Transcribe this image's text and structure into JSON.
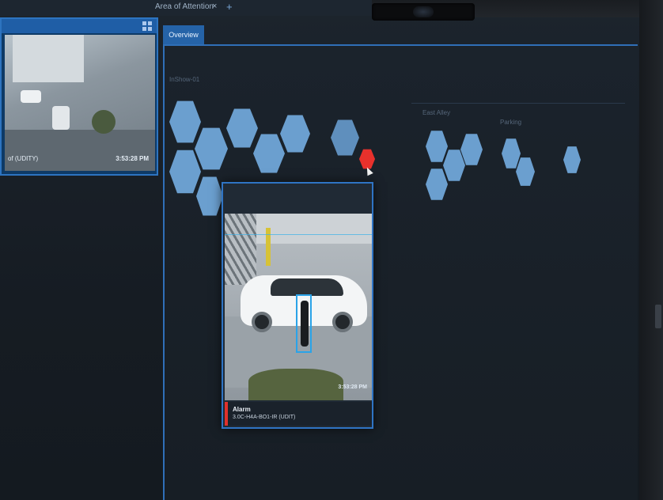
{
  "tabs": {
    "active_tab_title": "Area of Attention",
    "close_glyph": "×",
    "add_glyph": "+",
    "overview_label": "Overview"
  },
  "left_tile": {
    "label": "of (UDITY)",
    "timestamp": "3:53:28 PM"
  },
  "groups": {
    "group1_label": "InShow-01",
    "group2_label": "East Alley",
    "group3_label": "Parking"
  },
  "alarm_popup": {
    "timestamp": "3:53:28 PM",
    "title": "Alarm",
    "camera": "3.0C-H4A-BO1-IR (UDIT)"
  },
  "colors": {
    "hex_normal": "#6b9fcf",
    "hex_alarm": "#e8312c",
    "accent_blue": "#2f74c4"
  },
  "icons": {
    "grid": "grid-icon",
    "cursor": "cursor-icon",
    "close": "close-icon",
    "add": "plus-icon"
  }
}
